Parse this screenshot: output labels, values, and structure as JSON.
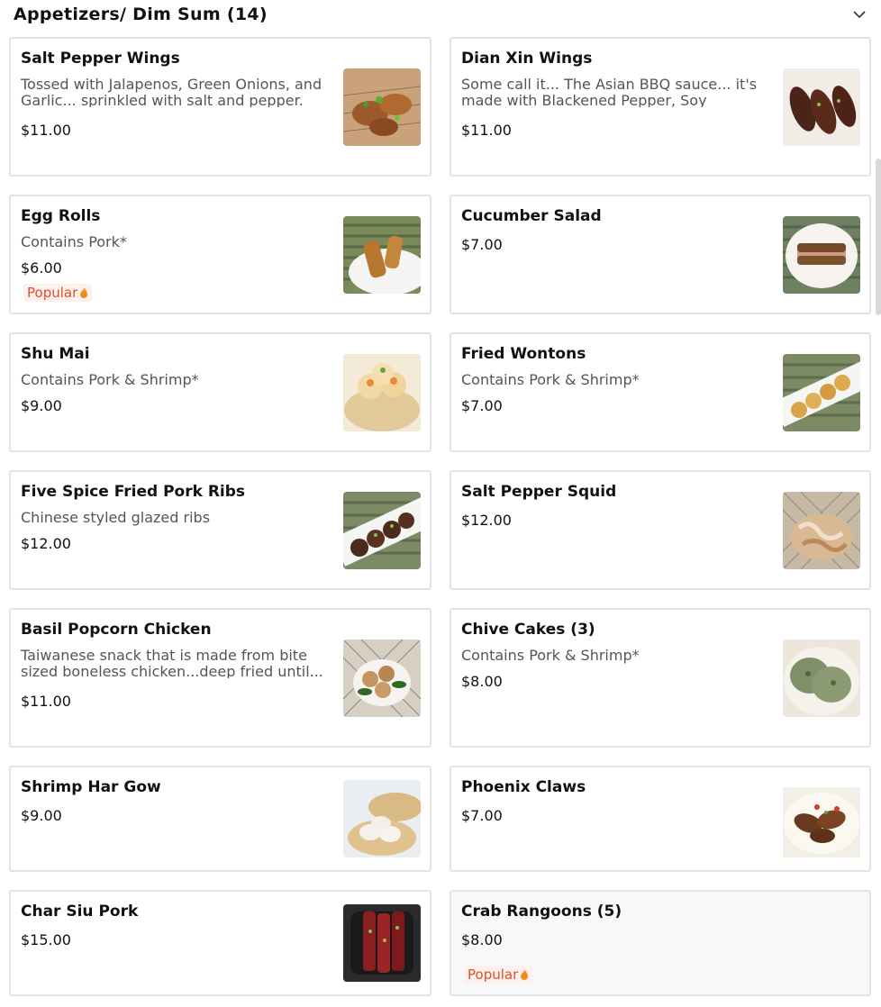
{
  "section": {
    "title": "Appetizers/ Dim Sum (14)"
  },
  "items": [
    {
      "name": "Salt Pepper Wings",
      "description": "Tossed with Jalapenos, Green Onions, and Garlic... sprinkled with salt and pepper. (D...",
      "price": "$11.00"
    },
    {
      "name": "Dian Xin Wings",
      "description": "Some call it... The Asian BBQ sauce... it's made with Blackened Pepper, Soy Sauce,...",
      "price": "$11.00"
    },
    {
      "name": "Egg Rolls",
      "description": "Contains Pork*",
      "price": "$6.00",
      "badge": "Popular"
    },
    {
      "name": "Cucumber Salad",
      "price": "$7.00"
    },
    {
      "name": "Shu Mai",
      "description": "Contains Pork & Shrimp*",
      "price": "$9.00"
    },
    {
      "name": "Fried Wontons",
      "description": "Contains Pork & Shrimp*",
      "price": "$7.00"
    },
    {
      "name": "Five Spice Fried Pork Ribs",
      "description": "Chinese styled glazed ribs",
      "price": "$12.00"
    },
    {
      "name": "Salt Pepper Squid",
      "price": "$12.00"
    },
    {
      "name": "Basil Popcorn Chicken",
      "description": "Taiwanese snack that is made from bite sized boneless chicken...deep fried until...",
      "price": "$11.00"
    },
    {
      "name": "Chive Cakes (3)",
      "description": "Contains Pork & Shrimp*",
      "price": "$8.00"
    },
    {
      "name": "Shrimp Har Gow",
      "price": "$9.00"
    },
    {
      "name": "Phoenix Claws",
      "price": "$7.00"
    },
    {
      "name": "Char Siu Pork",
      "price": "$15.00"
    },
    {
      "name": "Crab Rangoons (5)",
      "price": "$8.00",
      "badge": "Popular"
    }
  ],
  "colors": {
    "badge_text": "#e14d2a",
    "badge_bg": "#fdf1ee",
    "card_border": "#e3e3e3"
  },
  "icons": {
    "header_toggle": "chevron-down-icon",
    "badge": "flame-icon"
  }
}
